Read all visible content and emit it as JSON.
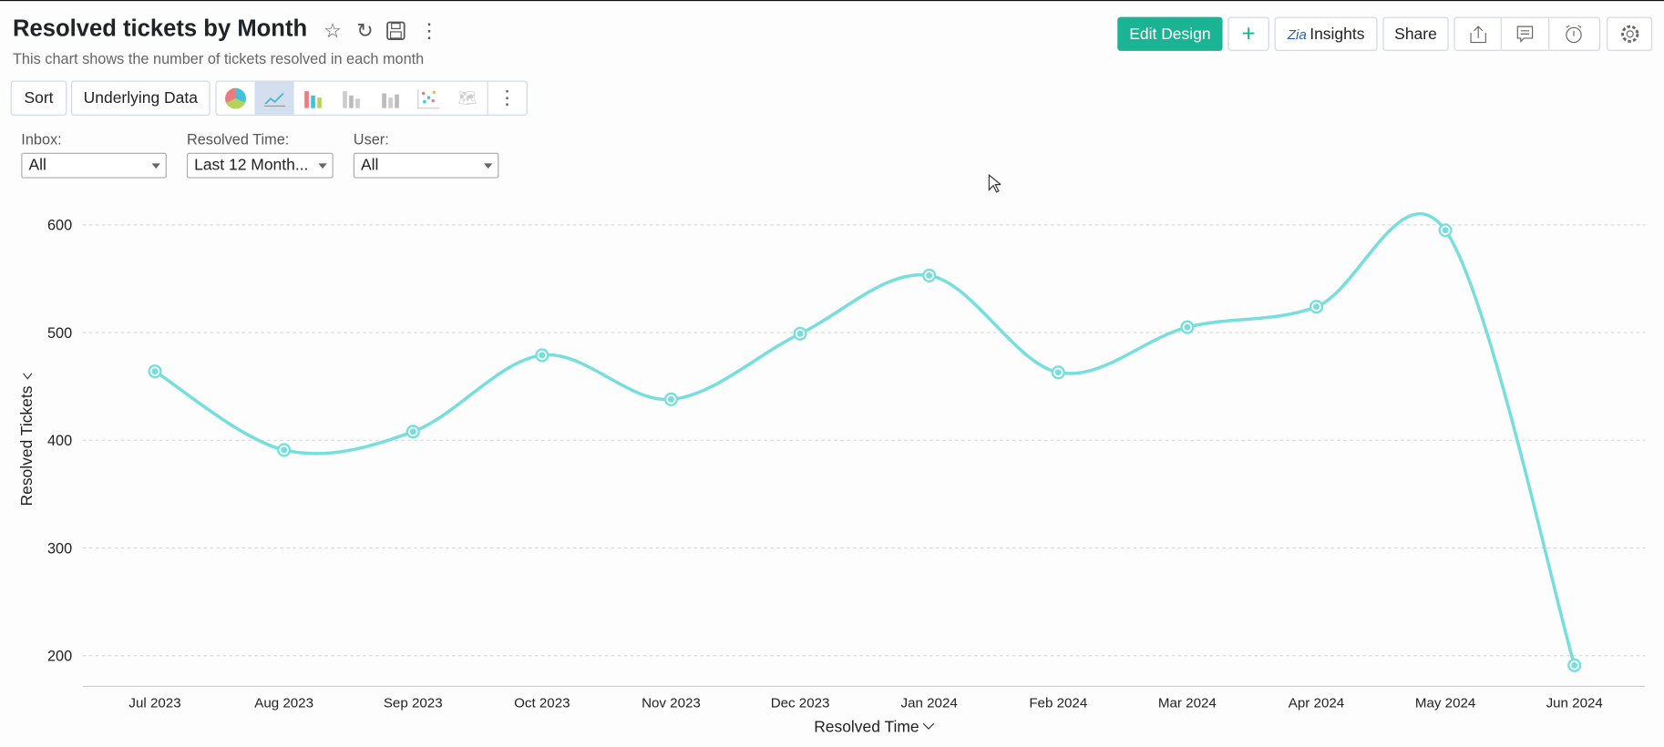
{
  "header": {
    "title": "Resolved tickets by Month",
    "subtitle": "This chart shows the number of tickets resolved in each month"
  },
  "toolbar": {
    "edit_design": "Edit Design",
    "add": "+",
    "insights": "Insights",
    "insights_logo": "Zia",
    "share": "Share",
    "sort": "Sort",
    "underlying_data": "Underlying Data"
  },
  "filters": [
    {
      "label": "Inbox:",
      "value": "All"
    },
    {
      "label": "Resolved Time:",
      "value": "Last 12 Month..."
    },
    {
      "label": "User:",
      "value": "All"
    }
  ],
  "chart_data": {
    "type": "line",
    "smooth": true,
    "categories": [
      "Jul 2023",
      "Aug 2023",
      "Sep 2023",
      "Oct 2023",
      "Nov 2023",
      "Dec 2023",
      "Jan 2024",
      "Feb 2024",
      "Mar 2024",
      "Apr 2024",
      "May 2024",
      "Jun 2024"
    ],
    "values": [
      464,
      391,
      408,
      479,
      438,
      499,
      553,
      463,
      505,
      524,
      595,
      191
    ],
    "xlabel": "Resolved Time",
    "ylabel": "Resolved Tickets",
    "yticks": [
      "200",
      "300",
      "400",
      "500",
      "600"
    ],
    "ylim": [
      200,
      600
    ],
    "grid": true,
    "line_color": "#76dfdd"
  }
}
